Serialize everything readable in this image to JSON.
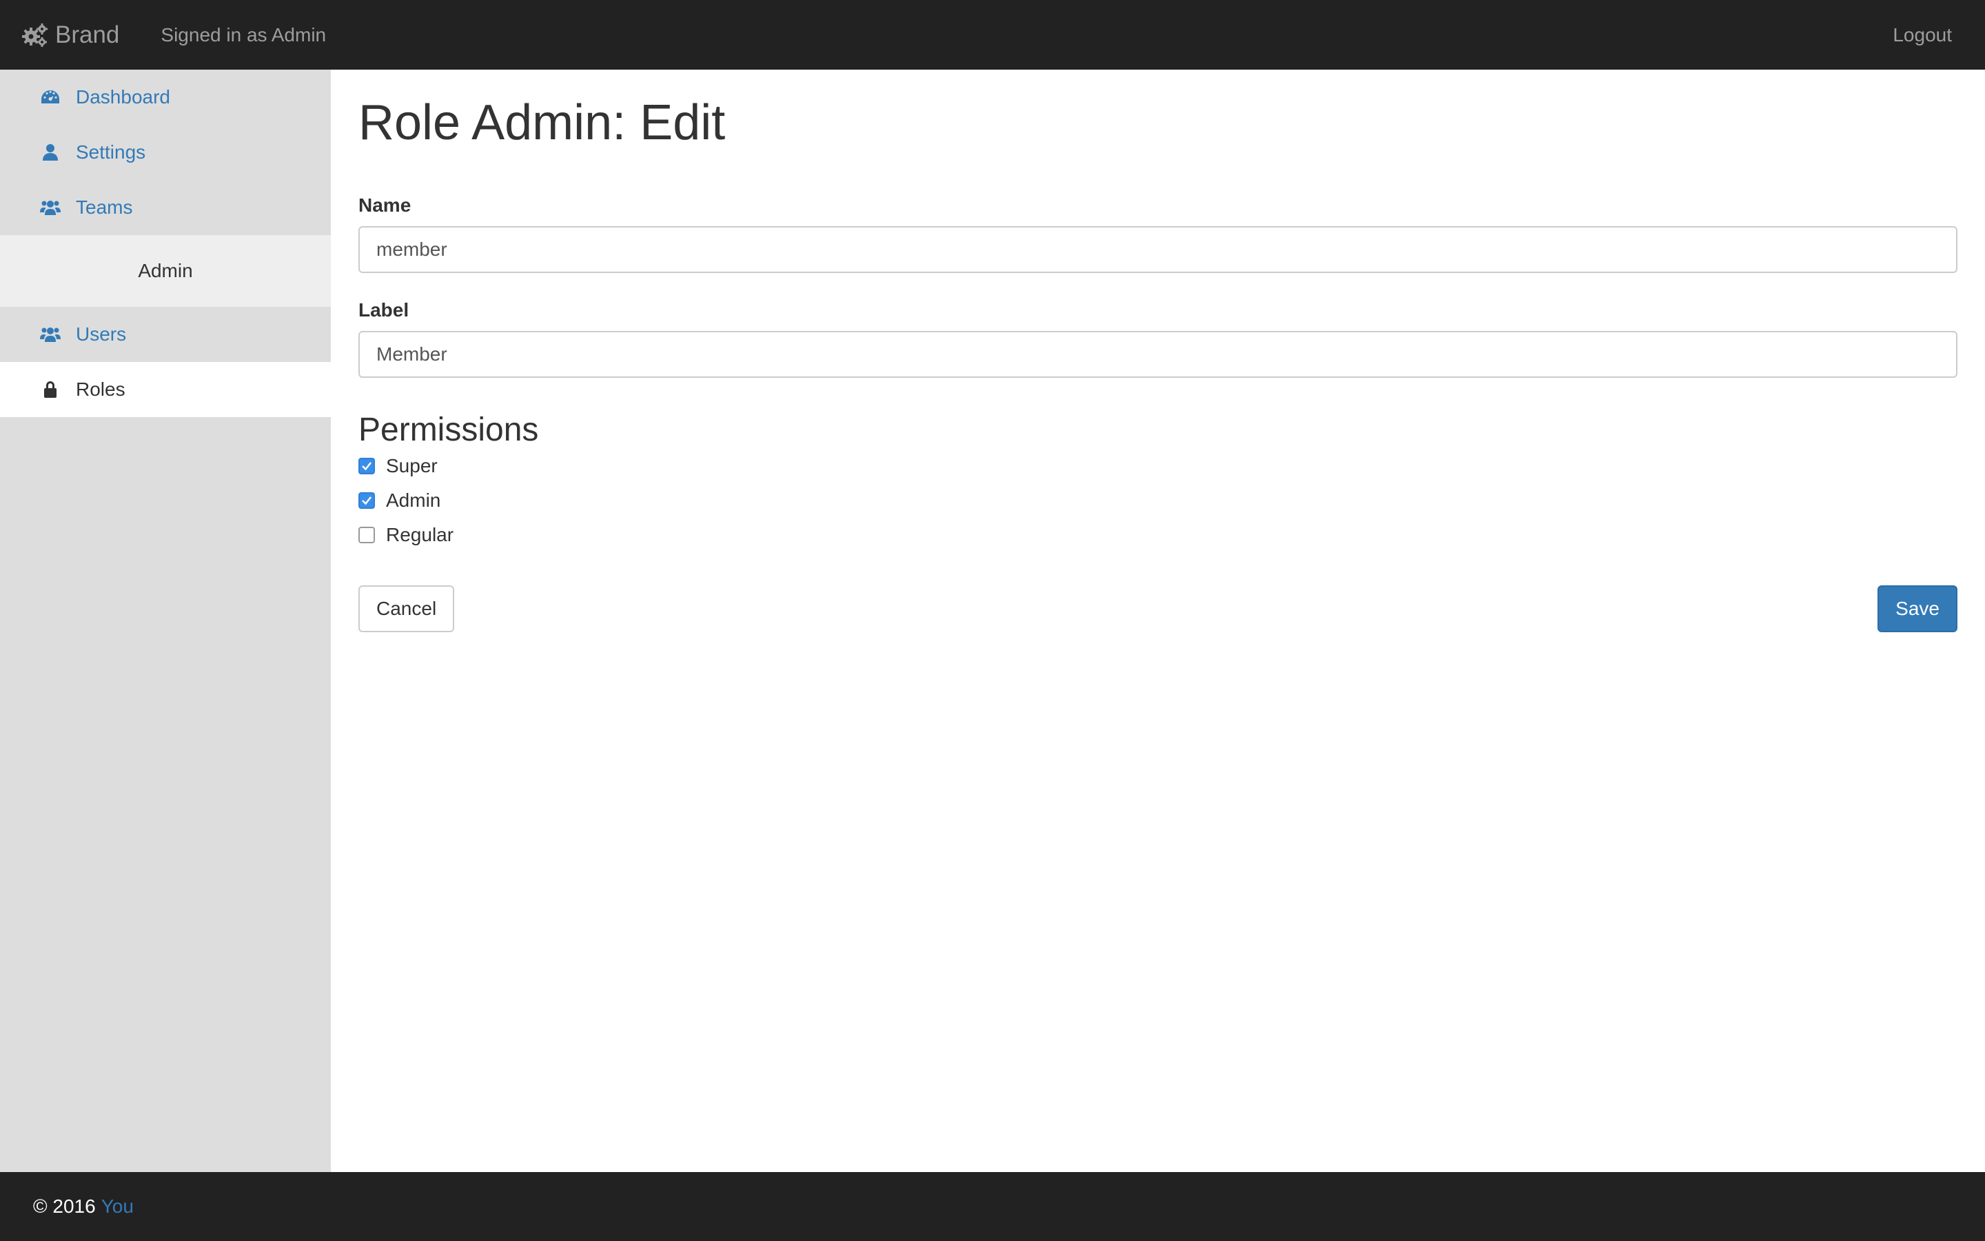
{
  "navbar": {
    "brand_label": "Brand",
    "signed_in_text": "Signed in as Admin",
    "logout_label": "Logout"
  },
  "sidebar": {
    "items": [
      {
        "label": "Dashboard",
        "icon": "dashboard-icon"
      },
      {
        "label": "Settings",
        "icon": "user-icon"
      },
      {
        "label": "Teams",
        "icon": "users-icon"
      }
    ],
    "admin_header": "Admin",
    "admin_items": [
      {
        "label": "Users",
        "icon": "users-icon"
      },
      {
        "label": "Roles",
        "icon": "lock-icon",
        "active": true
      }
    ]
  },
  "main": {
    "title": "Role Admin: Edit",
    "name_label": "Name",
    "name_value": "member",
    "label_label": "Label",
    "label_value": "Member",
    "permissions_heading": "Permissions",
    "permissions": [
      {
        "label": "Super",
        "checked": true
      },
      {
        "label": "Admin",
        "checked": true
      },
      {
        "label": "Regular",
        "checked": false
      }
    ],
    "cancel_label": "Cancel",
    "save_label": "Save"
  },
  "footer": {
    "copyright": "© 2016",
    "link_label": "You"
  },
  "colors": {
    "navbar_bg": "#222222",
    "link": "#337ab7",
    "primary": "#337ab7",
    "sidebar_bg": "#dddddd",
    "checkbox_checked": "#3b8ee8"
  }
}
